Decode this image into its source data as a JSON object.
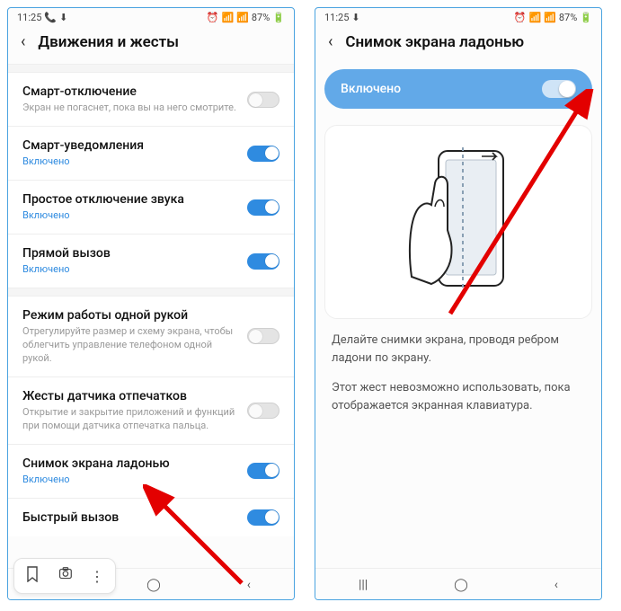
{
  "status": {
    "time": "11:25",
    "battery": "87%"
  },
  "left": {
    "title": "Движения и жесты",
    "rows": [
      {
        "title": "Смарт-отключение",
        "sub": "Экран не погаснет, пока вы на него смотрите.",
        "subBlue": false,
        "on": false
      },
      {
        "title": "Смарт-уведомления",
        "sub": "Включено",
        "subBlue": true,
        "on": true
      },
      {
        "title": "Простое отключение звука",
        "sub": "Включено",
        "subBlue": true,
        "on": true
      },
      {
        "title": "Прямой вызов",
        "sub": "Включено",
        "subBlue": true,
        "on": true
      },
      {
        "title": "Режим работы одной рукой",
        "sub": "Отрегулируйте размер и схему экрана, чтобы облегчить управление телефоном одной рукой.",
        "subBlue": false,
        "on": false
      },
      {
        "title": "Жесты датчика отпечатков",
        "sub": "Открытие и закрытие приложений и функций при помощи датчика отпечатка пальца.",
        "subBlue": false,
        "on": false
      },
      {
        "title": "Снимок экрана ладонью",
        "sub": "Включено",
        "subBlue": true,
        "on": true
      },
      {
        "title": "Быстрый вызов",
        "sub": "",
        "subBlue": false,
        "on": true
      }
    ]
  },
  "right": {
    "title": "Снимок экрана ладонью",
    "master": "Включено",
    "desc1": "Делайте снимки экрана, проводя ребром ладони по экрану.",
    "desc2": "Этот жест невозможно использовать, пока отображается экранная клавиатура."
  }
}
